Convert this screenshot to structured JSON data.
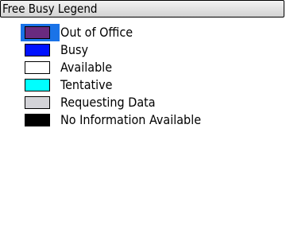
{
  "header": {
    "title": "Free Busy Legend"
  },
  "legend": {
    "items": [
      {
        "label": "Out of Office",
        "color": "#6a2a7f",
        "selected": true
      },
      {
        "label": "Busy",
        "color": "#0011ff",
        "selected": false
      },
      {
        "label": "Available",
        "color": "#ffffff",
        "selected": false
      },
      {
        "label": "Tentative",
        "color": "#00ffff",
        "selected": false
      },
      {
        "label": "Requesting Data",
        "color": "#d3d3d8",
        "selected": false
      },
      {
        "label": "No Information Available",
        "color": "#000000",
        "selected": false
      }
    ]
  }
}
